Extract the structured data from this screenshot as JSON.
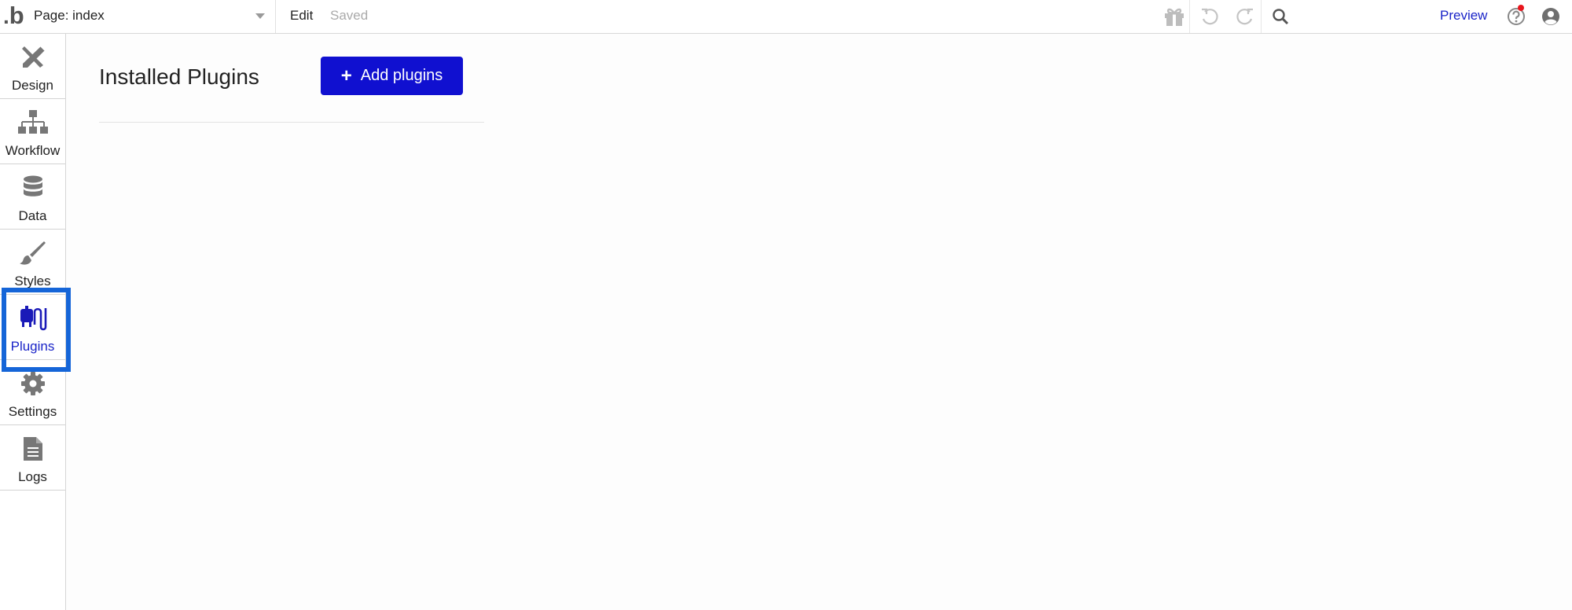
{
  "topbar": {
    "logo": "b",
    "page_label": "Page: index",
    "edit_label": "Edit",
    "saved_label": "Saved",
    "preview_label": "Preview"
  },
  "sidebar": {
    "items": [
      {
        "label": "Design",
        "icon": "design-icon"
      },
      {
        "label": "Workflow",
        "icon": "workflow-icon"
      },
      {
        "label": "Data",
        "icon": "database-icon"
      },
      {
        "label": "Styles",
        "icon": "brush-icon"
      },
      {
        "label": "Plugins",
        "icon": "plug-icon",
        "active": true
      },
      {
        "label": "Settings",
        "icon": "gear-icon"
      },
      {
        "label": "Logs",
        "icon": "document-icon"
      }
    ]
  },
  "main": {
    "title": "Installed Plugins",
    "add_button_label": "Add plugins"
  },
  "colors": {
    "accent": "#1010d0",
    "link": "#1a24c8",
    "highlight": "#1565d8",
    "notification": "#e8151c"
  }
}
